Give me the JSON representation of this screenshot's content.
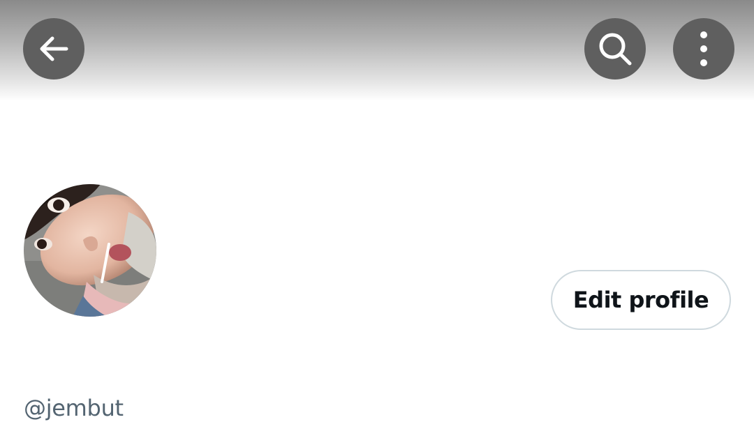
{
  "header": {
    "back_icon": "arrow-left-icon",
    "search_icon": "search-icon",
    "more_icon": "more-vertical-icon",
    "button_color": "#5f5f5f"
  },
  "profile": {
    "avatar_alt": "profile-photo",
    "edit_button_label": "Edit profile",
    "handle": "@jembut",
    "handle_color": "#536471",
    "button_border_color": "#cfd9de"
  }
}
